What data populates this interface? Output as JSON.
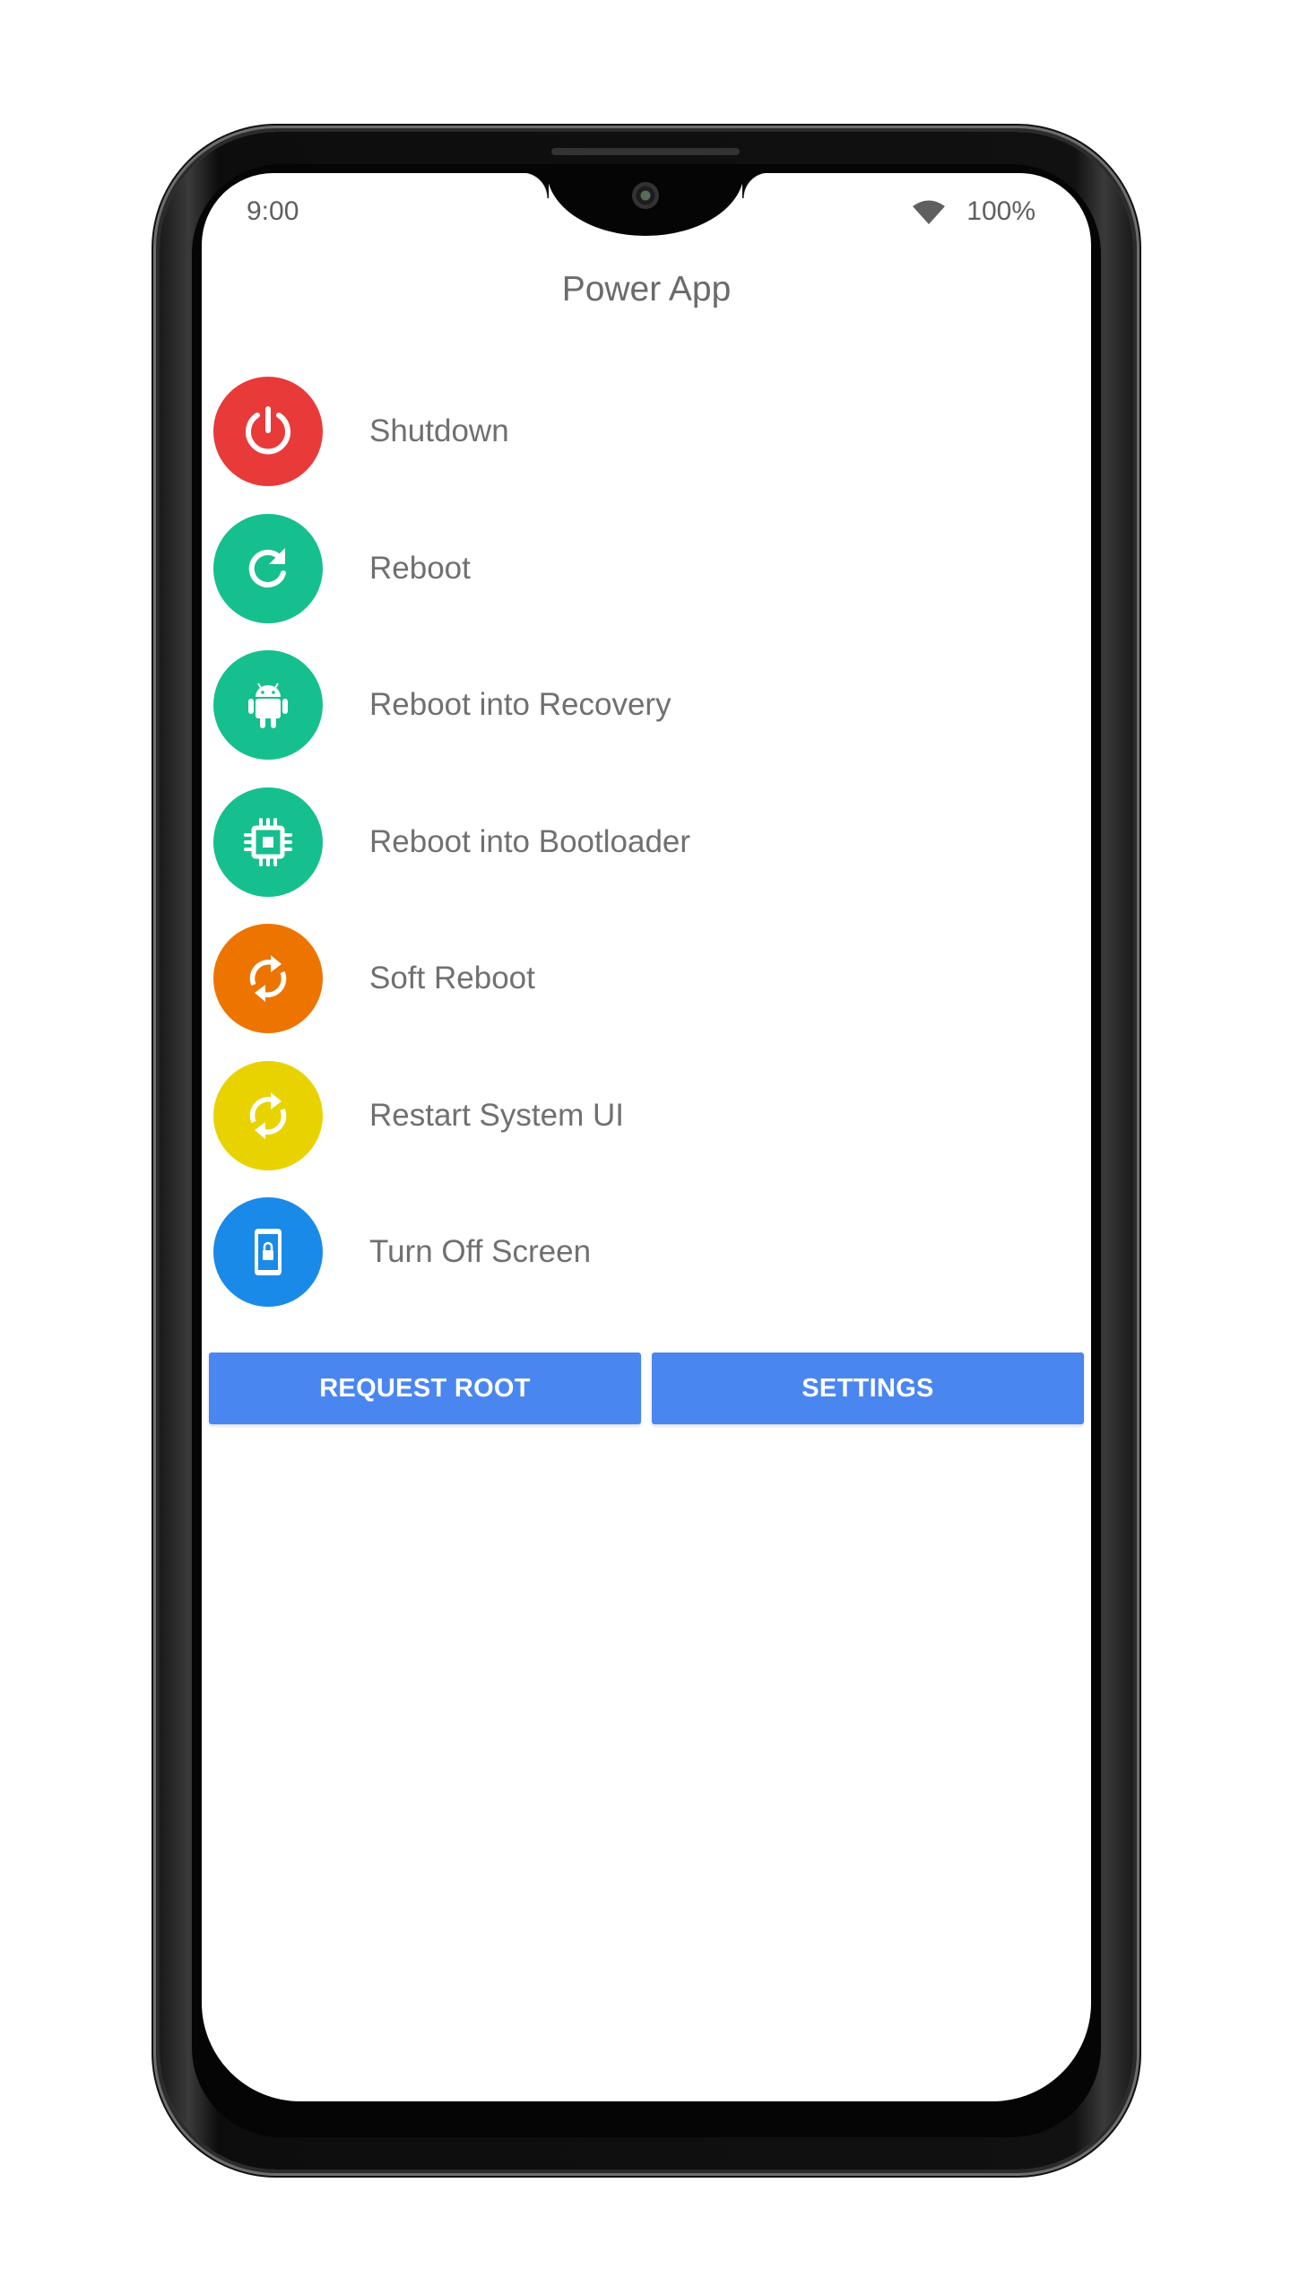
{
  "status_bar": {
    "time": "9:00",
    "battery": "100%",
    "wifi_icon": "wifi-icon"
  },
  "app": {
    "title": "Power App"
  },
  "menu": {
    "items": [
      {
        "label": "Shutdown",
        "icon": "power-icon",
        "color": "#e93a3a"
      },
      {
        "label": "Reboot",
        "icon": "refresh-icon",
        "color": "#16bf8e"
      },
      {
        "label": "Reboot into Recovery",
        "icon": "android-icon",
        "color": "#16bf8e"
      },
      {
        "label": "Reboot into Bootloader",
        "icon": "chip-icon",
        "color": "#16bf8e"
      },
      {
        "label": "Soft Reboot",
        "icon": "sync-icon",
        "color": "#ee7400"
      },
      {
        "label": "Restart System UI",
        "icon": "sync-icon",
        "color": "#e8d300"
      },
      {
        "label": "Turn Off Screen",
        "icon": "lock-phone-icon",
        "color": "#1a8ae8"
      }
    ]
  },
  "actions": {
    "request_root": "REQUEST ROOT",
    "settings": "SETTINGS",
    "button_color": "#4a86f0"
  }
}
